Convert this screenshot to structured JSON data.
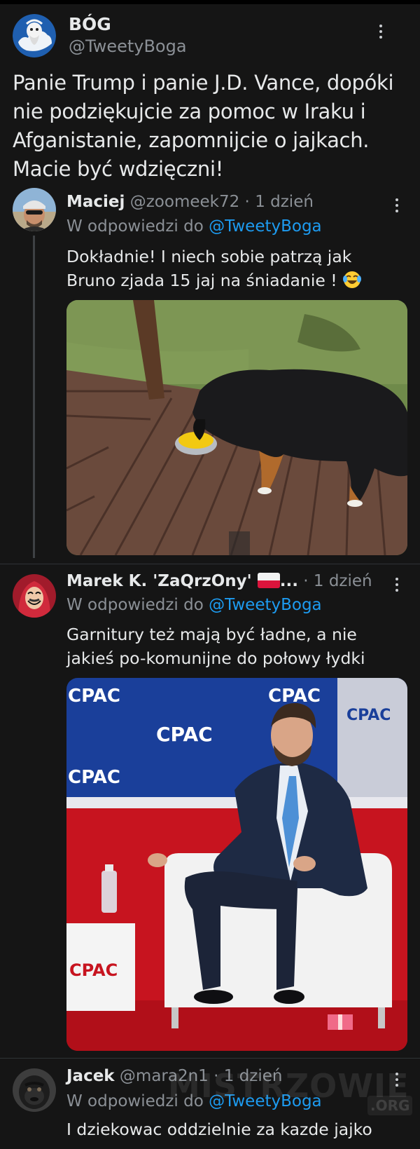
{
  "main_tweet": {
    "author_name": "BÓG",
    "author_handle": "@TweetyBoga",
    "text": "Panie Trump i panie J.D. Vance, dopóki nie podziękujcie za pomoc w Iraku i Afganistanie, zapomnijcie o jajkach. Macie być wdzięczni!"
  },
  "replies": [
    {
      "author_name": "Maciej",
      "author_handle": "@zoomeek72",
      "separator": " · ",
      "time": "1 dzień",
      "reply_prefix": "W odpowiedzi do ",
      "reply_to": "@TweetyBoga",
      "text": "Dokładnie! I niech sobie patrzą jak Bruno zjada 15 jaj na śniadanie ! ",
      "emoji": "face-with-tears-of-joy"
    },
    {
      "author_name": "Marek K. 'ZaQrzOny' ",
      "author_suffix": "...",
      "separator": " · ",
      "time": "1 dzień",
      "reply_prefix": "W odpowiedzi do ",
      "reply_to": "@TweetyBoga",
      "text": "Garnitury też mają być ładne, a nie jakieś po-komunijne do połowy łydki",
      "flag": "poland-flag"
    },
    {
      "author_name": "Jacek",
      "author_handle": "@mara2n1",
      "separator": " · ",
      "time": "1 dzień",
      "reply_prefix": "W odpowiedzi do ",
      "reply_to": "@TweetyBoga",
      "text": "I dziekowac oddzielnie za kazde jajko"
    }
  ],
  "photo_texts": {
    "logo": "CPAC"
  },
  "watermark": {
    "text": "MISTRZOWIE",
    "suffix": ".ORG"
  },
  "colors": {
    "background": "#151515",
    "text": "#e7e9ea",
    "muted": "#8b9096",
    "link": "#1d9bf0",
    "divider": "#2f3336"
  }
}
